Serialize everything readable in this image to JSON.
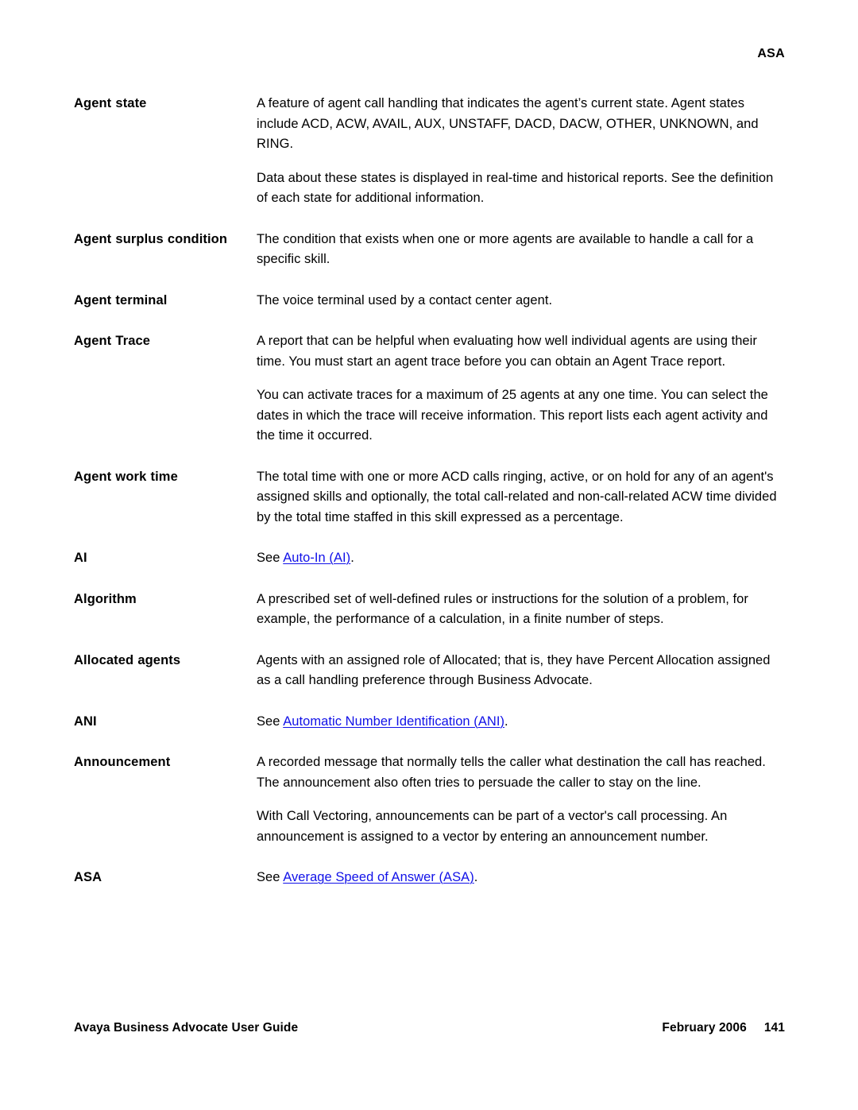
{
  "header": {
    "running_head": "ASA"
  },
  "glossary": {
    "entries": [
      {
        "term": "Agent state",
        "paragraphs": [
          "A feature of agent call handling that indicates the agent’s current state. Agent states include ACD, ACW, AVAIL, AUX, UNSTAFF, DACD, DACW, OTHER, UNKNOWN, and RING.",
          "Data about these states is displayed in real-time and historical reports. See the definition of each state for additional information."
        ]
      },
      {
        "term": "Agent surplus condition",
        "paragraphs": [
          "The condition that exists when one or more agents are available to handle a call for a specific skill."
        ]
      },
      {
        "term": "Agent terminal",
        "paragraphs": [
          "The voice terminal used by a contact center agent."
        ]
      },
      {
        "term": "Agent Trace",
        "paragraphs": [
          "A report that can be helpful when evaluating how well individual agents are using their time. You must start an agent trace before you can obtain an Agent Trace report.",
          "You can activate traces for a maximum of 25 agents at any one time. You can select the dates in which the trace will receive information. This report lists each agent activity and the time it occurred."
        ]
      },
      {
        "term": "Agent work time",
        "paragraphs": [
          "The total time with one or more ACD calls ringing, active, or on hold for any of an agent's assigned skills and optionally, the total call-related and non-call-related ACW time divided by the total time staffed in this skill expressed as a percentage."
        ]
      },
      {
        "term": "AI",
        "see_prefix": "See ",
        "link_text": "Auto-In (AI)",
        "see_suffix": "."
      },
      {
        "term": "Algorithm",
        "paragraphs": [
          "A prescribed set of well-defined rules or instructions for the solution of a problem, for example, the performance of a calculation, in a finite number of steps."
        ]
      },
      {
        "term": "Allocated agents",
        "paragraphs": [
          "Agents with an assigned role of Allocated; that is, they have Percent Allocation assigned as a call handling preference through Business Advocate."
        ]
      },
      {
        "term": "ANI",
        "see_prefix": "See ",
        "link_text": "Automatic Number Identification (ANI)",
        "see_suffix": "."
      },
      {
        "term": "Announcement",
        "paragraphs": [
          "A recorded message that normally tells the caller what destination the call has reached. The announcement also often tries to persuade the caller to stay on the line.",
          "With Call Vectoring, announcements can be part of a vector's call processing. An announcement is assigned to a vector by entering an announcement number."
        ]
      },
      {
        "term": "ASA",
        "see_prefix": "See ",
        "link_text": "Average Speed of Answer (ASA)",
        "see_suffix": "."
      }
    ]
  },
  "footer": {
    "document_title": "Avaya Business Advocate User Guide",
    "date": "February 2006",
    "page_number": "141"
  },
  "colors": {
    "link": "#1111e8",
    "text": "#000000",
    "background": "#ffffff"
  }
}
